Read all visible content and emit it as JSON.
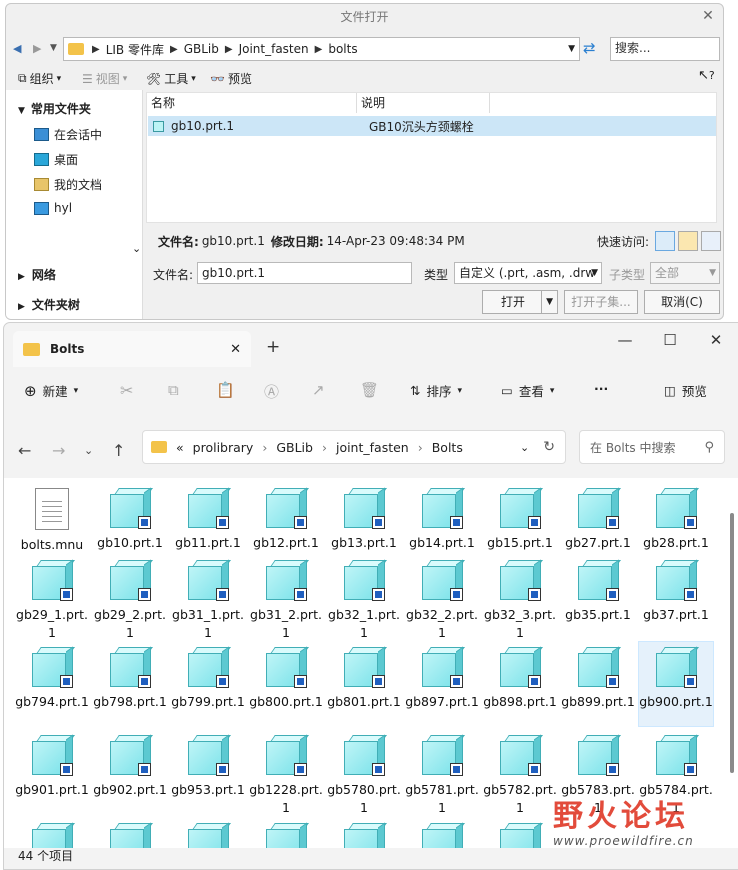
{
  "dialog": {
    "title": "文件打开",
    "path": [
      "LIB 零件库",
      "GBLib",
      "Joint_fasten",
      "bolts"
    ],
    "search_placeholder": "搜索...",
    "toolbar": {
      "organize": "组织",
      "view": "视图",
      "tools": "工具",
      "preview": "预览",
      "help": "?"
    },
    "sidebar": {
      "favorites_header": "常用文件夹",
      "items": [
        "在会话中",
        "桌面",
        "我的文档",
        "hyl"
      ],
      "network": "网络",
      "folder_tree": "文件夹树"
    },
    "columns": {
      "name": "名称",
      "desc": "说明"
    },
    "files": [
      {
        "name": "gb10.prt.1",
        "desc": "GB10沉头方颈螺栓"
      }
    ],
    "status": {
      "file_label": "文件名:",
      "file_value": "gb10.prt.1",
      "modified_label": "修改日期:",
      "modified_value": "14-Apr-23 09:48:34 PM",
      "quick_access": "快速访问:"
    },
    "filename_label": "文件名:",
    "filename_value": "gb10.prt.1",
    "type_label": "类型",
    "type_value": "自定义 (.prt, .asm, .drw",
    "subtype_label": "子类型",
    "subtype_value": "全部",
    "open_button": "打开",
    "open_sub_button": "打开子集...",
    "cancel_button": "取消(C)"
  },
  "explorer": {
    "tab_title": "Bolts",
    "commands": {
      "new": "新建",
      "sort": "排序",
      "view": "查看",
      "more": "···",
      "preview": "预览"
    },
    "breadcrumb": [
      "«",
      "prolibrary",
      "GBLib",
      "joint_fasten",
      "Bolts"
    ],
    "search_placeholder": "在 Bolts 中搜索",
    "files": [
      "bolts.mnu",
      "gb10.prt.1",
      "gb11.prt.1",
      "gb12.prt.1",
      "gb13.prt.1",
      "gb14.prt.1",
      "gb15.prt.1",
      "gb27.prt.1",
      "gb28.prt.1",
      "gb29_1.prt.1",
      "gb29_2.prt.1",
      "gb31_1.prt.1",
      "gb31_2.prt.1",
      "gb32_1.prt.1",
      "gb32_2.prt.1",
      "gb32_3.prt.1",
      "gb35.prt.1",
      "gb37.prt.1",
      "gb794.prt.1",
      "gb798.prt.1",
      "gb799.prt.1",
      "gb800.prt.1",
      "gb801.prt.1",
      "gb897.prt.1",
      "gb898.prt.1",
      "gb899.prt.1",
      "gb900.prt.1",
      "gb901.prt.1",
      "gb902.prt.1",
      "gb953.prt.1",
      "gb1228.prt.1",
      "gb5780.prt.1",
      "gb5781.prt.1",
      "gb5782.prt.1",
      "gb5783.prt.1",
      "gb5784.prt.1"
    ],
    "item_count": "44 个项目",
    "watermark_cn": "野火论坛",
    "watermark_url": "www.proewildfire.cn"
  }
}
